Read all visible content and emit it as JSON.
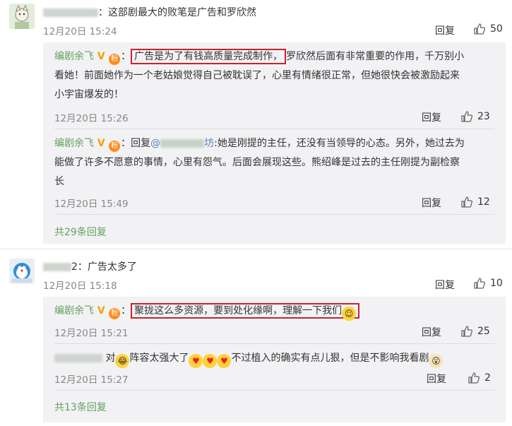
{
  "comments": [
    {
      "user": "",
      "text": "：这部剧最大的败笔是广告和罗欣然",
      "time": "12月20日 15:24",
      "reply_label": "回复",
      "likes": "50",
      "replies": [
        {
          "author": "编剧余飞",
          "prefix": "：",
          "highlight": "广告是为了有钱高质量完成制作，",
          "lines": [
            "罗欣然后面有非常重要的作用，千万别小",
            "看她！前面她作为一个老姑娘觉得自己被耽误了，心里有情绪很正常，但她很快会被激励起来",
            "小宇宙爆发的！"
          ],
          "time": "12月20日 15:26",
          "reply_label": "回复",
          "likes": "23"
        },
        {
          "author": "编剧余飞",
          "prefix": "：回复",
          "mention": "@",
          "mention_tail": "坊",
          "lines": [
            ":她是刚提的主任，还没有当领导的心态。另外，她过去为",
            "能做了许多不愿意的事情，心里有怨气。后面会展现这些。熊绍峰是过去的主任刚提为副检察",
            "长"
          ],
          "time": "12月20日 15:49",
          "reply_label": "回复",
          "likes": "12"
        }
      ],
      "more_replies": "共29条回复"
    },
    {
      "user": "2",
      "text": "：广告太多了",
      "time": "12月20日 15:18",
      "reply_label": "回复",
      "likes": "10",
      "replies": [
        {
          "author": "编剧余飞",
          "prefix": "：",
          "highlight": "聚拢这么多资源，要到处化缘啊，理解一下我们",
          "time": "12月20日 15:21",
          "reply_label": "回复",
          "likes": "25"
        },
        {
          "author": "",
          "part1": "对",
          "part2": "阵容太强大了",
          "part3": "不过植入的确实有点儿狠，但是不影响我看剧",
          "time": "12月20日 15:27",
          "reply_label": "回复",
          "likes": "2"
        }
      ],
      "more_replies": "共13条回复"
    }
  ],
  "colors": {
    "author": "#63a15b",
    "highlight_border": "#c8232c",
    "sub_bg": "#f2f2f5",
    "vip": "#f4a000"
  },
  "icons": [
    "thumb-up-icon",
    "verified-v-icon",
    "fan-badge-icon",
    "smile-emoji-icon",
    "heart-eyes-emoji-icon"
  ]
}
